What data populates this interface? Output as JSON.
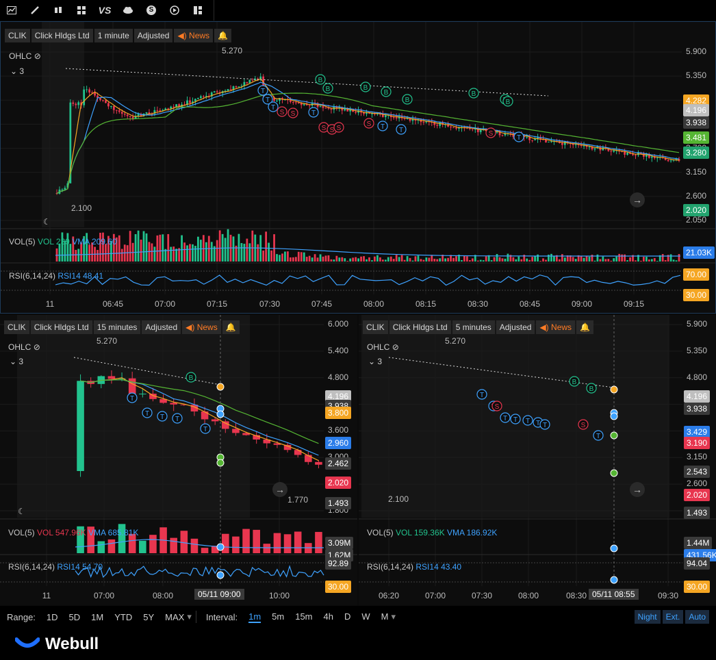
{
  "toolbar": {
    "icons": [
      "chart-icon",
      "pencil-icon",
      "candles-icon",
      "grid-icon",
      "compare-icon",
      "cloud-icon",
      "dollar-icon",
      "play-icon",
      "layout-icon"
    ],
    "compare_label": "VS",
    "dollar_label": "S"
  },
  "top": {
    "symbol": "CLIK",
    "name": "Click Hldgs Ltd",
    "interval": "1 minute",
    "adjusted": "Adjusted",
    "news": "News",
    "ohlc_label": "OHLC",
    "ma_count": "3",
    "high_label": "5.270",
    "low_label": "2.100",
    "y_ticks": [
      "5.900",
      "5.350",
      "4.800",
      "4.250",
      "3.700",
      "3.150",
      "2.600",
      "2.050"
    ],
    "tags": [
      {
        "text": "4.282",
        "color": "#f5a623"
      },
      {
        "text": "4.196",
        "color": "#bfbfbf"
      },
      {
        "text": "3.938",
        "color": "#3a3a3a"
      },
      {
        "text": "3.481",
        "color": "#55b533"
      },
      {
        "text": "3.280",
        "color": "#22a36e"
      },
      {
        "text": "2.020",
        "color": "#22a36e"
      }
    ],
    "vol_label": "VOL(5)",
    "vol_value": "VOL 239",
    "vma_value": "VMA 209.60",
    "vol_tag": "21.03K",
    "rsi_label": "RSI(6,14,24)",
    "rsi_value": "RSI14 48.41",
    "rsi_tag_hi": "70.00",
    "rsi_tag_lo": "30.00",
    "x_ticks": [
      "11",
      "06:45",
      "07:00",
      "07:15",
      "07:30",
      "07:45",
      "08:00",
      "08:15",
      "08:30",
      "08:45",
      "09:00",
      "09:15"
    ]
  },
  "left": {
    "symbol": "CLIK",
    "name": "Click Hldgs Ltd",
    "interval": "15 minutes",
    "adjusted": "Adjusted",
    "news": "News",
    "ohlc_label": "OHLC",
    "ma_count": "3",
    "high_label": "5.270",
    "low_label": "1.770",
    "y_ticks": [
      "6.000",
      "5.400",
      "4.800",
      "4.200",
      "3.600",
      "3.000",
      "2.400",
      "1.800"
    ],
    "tags": [
      {
        "text": "4.196",
        "color": "#bfbfbf"
      },
      {
        "text": "3.938",
        "color": "#3a3a3a"
      },
      {
        "text": "3.800",
        "color": "#f5a623"
      },
      {
        "text": "2.960",
        "color": "#2b7de9"
      },
      {
        "text": "2.462",
        "color": "#3a3a3a"
      },
      {
        "text": "2.020",
        "color": "#e8364f"
      },
      {
        "text": "1.493",
        "color": "#3a3a3a"
      }
    ],
    "vol_label": "VOL(5)",
    "vol_value": "VOL 547.96K",
    "vma_value": "VMA 685.81K",
    "vol_tag": "3.09M",
    "vol_tag2": "1.62M",
    "rsi_label": "RSI(6,14,24)",
    "rsi_value": "RSI14 54.70",
    "rsi_tag_hi": "92.89",
    "rsi_tag_lo": "30.00",
    "x_ticks": [
      "11",
      "07:00",
      "08:00",
      "10:00"
    ],
    "crosshair": "05/11 09:00"
  },
  "right": {
    "symbol": "CLIK",
    "name": "Click Hldgs Ltd",
    "interval": "5 minutes",
    "adjusted": "Adjusted",
    "news": "News",
    "ohlc_label": "OHLC",
    "ma_count": "3",
    "high_label": "5.270",
    "low_label": "2.100",
    "y_ticks": [
      "5.900",
      "5.350",
      "4.800",
      "4.250",
      "3.700",
      "3.150",
      "2.600",
      "2.050"
    ],
    "tags": [
      {
        "text": "4.196",
        "color": "#bfbfbf"
      },
      {
        "text": "3.938",
        "color": "#3a3a3a"
      },
      {
        "text": "3.429",
        "color": "#2b7de9"
      },
      {
        "text": "3.190",
        "color": "#e8364f"
      },
      {
        "text": "2.543",
        "color": "#3a3a3a"
      },
      {
        "text": "2.020",
        "color": "#e8364f"
      },
      {
        "text": "1.493",
        "color": "#3a3a3a"
      }
    ],
    "vol_label": "VOL(5)",
    "vol_value": "VOL 159.36K",
    "vma_value": "VMA 186.92K",
    "vol_tag": "1.44M",
    "vol_tag2": "431.56K",
    "rsi_label": "RSI(6,14,24)",
    "rsi_value": "RSI14 43.40",
    "rsi_tag_hi": "94.04",
    "rsi_tag_lo": "30.00",
    "x_ticks": [
      "06:20",
      "07:00",
      "07:30",
      "08:00",
      "08:30",
      "09:30"
    ],
    "crosshair": "05/11 08:55"
  },
  "bottom": {
    "range_label": "Range:",
    "ranges": [
      "1D",
      "5D",
      "1M",
      "YTD",
      "5Y",
      "MAX"
    ],
    "interval_label": "Interval:",
    "intervals": [
      "1m",
      "5m",
      "15m",
      "4h",
      "D",
      "W",
      "M"
    ],
    "active_interval": "1m",
    "toggles": [
      "Night",
      "Ext.",
      "Auto"
    ]
  },
  "brand": {
    "name": "Webull"
  },
  "colors": {
    "up": "#22c38e",
    "down": "#e8364f",
    "ma1": "#f5a623",
    "ma2": "#3ea2ff",
    "ma3": "#55b533",
    "accent": "#3ea2ff"
  }
}
